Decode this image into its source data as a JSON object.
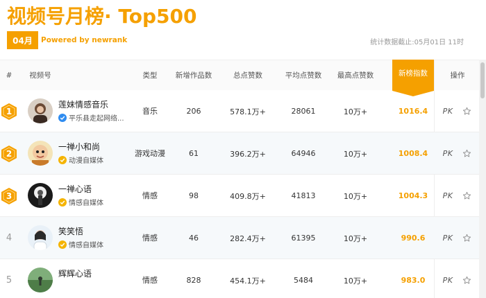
{
  "header": {
    "title": "视频号月榜· Top500",
    "month": "04月",
    "powered": "Powered by newrank",
    "stat_date": "统计数据截止:05月01日 11时"
  },
  "table": {
    "columns": {
      "rank": "#",
      "account": "视频号",
      "type": "类型",
      "new_works": "新增作品数",
      "total_likes": "总点赞数",
      "avg_likes": "平均点赞数",
      "max_likes": "最高点赞数",
      "index": "新榜指数",
      "ops": "操作"
    },
    "rows": [
      {
        "rank": "1",
        "medal": true,
        "name": "莲妹情感音乐",
        "sub": "平乐县走起网络...",
        "badge": "blue",
        "type": "音乐",
        "new_works": "206",
        "total_likes": "578.1万+",
        "avg_likes": "28061",
        "max_likes": "10万+",
        "index": "1016.4",
        "pk": "PK"
      },
      {
        "rank": "2",
        "medal": true,
        "name": "一禅小和尚",
        "sub": "动漫自媒体",
        "badge": "gold",
        "type": "游戏动漫",
        "new_works": "61",
        "total_likes": "396.2万+",
        "avg_likes": "64946",
        "max_likes": "10万+",
        "index": "1008.4",
        "pk": "PK"
      },
      {
        "rank": "3",
        "medal": true,
        "name": "一禅心语",
        "sub": "情感自媒体",
        "badge": "gold",
        "type": "情感",
        "new_works": "98",
        "total_likes": "409.8万+",
        "avg_likes": "41813",
        "max_likes": "10万+",
        "index": "1004.3",
        "pk": "PK"
      },
      {
        "rank": "4",
        "medal": false,
        "name": "笑笑悟",
        "sub": "情感自媒体",
        "badge": "gold",
        "type": "情感",
        "new_works": "46",
        "total_likes": "282.4万+",
        "avg_likes": "61395",
        "max_likes": "10万+",
        "index": "990.6",
        "pk": "PK"
      },
      {
        "rank": "5",
        "medal": false,
        "name": "辉辉心语",
        "sub": "",
        "badge": "",
        "type": "情感",
        "new_works": "828",
        "total_likes": "454.1万+",
        "avg_likes": "5484",
        "max_likes": "10万+",
        "index": "983.0",
        "pk": "PK"
      }
    ]
  },
  "icons": {
    "medal": "rank-medal-icon",
    "verified": "verified-check-icon",
    "star": "star-outline-icon"
  },
  "colors": {
    "accent": "#f5a000",
    "verified_blue": "#2f8cf0",
    "verified_gold": "#f5b400"
  }
}
